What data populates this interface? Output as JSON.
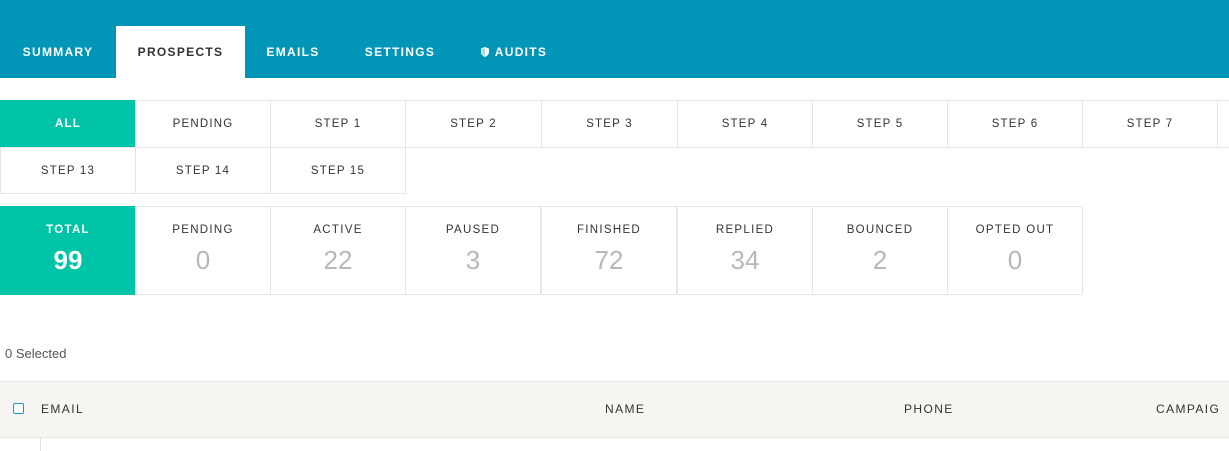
{
  "nav": {
    "tabs": [
      {
        "label": "SUMMARY",
        "active": false
      },
      {
        "label": "PROSPECTS",
        "active": true
      },
      {
        "label": "EMAILS",
        "active": false
      },
      {
        "label": "SETTINGS",
        "active": false
      },
      {
        "label": "AUDITS",
        "active": false,
        "icon": "shield-icon"
      }
    ]
  },
  "steps": {
    "row1": [
      "ALL",
      "PENDING",
      "STEP 1",
      "STEP 2",
      "STEP 3",
      "STEP 4",
      "STEP 5",
      "STEP 6",
      "STEP 7"
    ],
    "row2": [
      "STEP 13",
      "STEP 14",
      "STEP 15"
    ],
    "active": "ALL"
  },
  "stats": [
    {
      "label": "TOTAL",
      "value": "99",
      "active": true
    },
    {
      "label": "PENDING",
      "value": "0"
    },
    {
      "label": "ACTIVE",
      "value": "22"
    },
    {
      "label": "PAUSED",
      "value": "3"
    },
    {
      "label": "FINISHED",
      "value": "72"
    },
    {
      "label": "REPLIED",
      "value": "34"
    },
    {
      "label": "BOUNCED",
      "value": "2"
    },
    {
      "label": "OPTED OUT",
      "value": "0"
    }
  ],
  "selection": {
    "text": "0 Selected"
  },
  "table": {
    "columns": [
      "EMAIL",
      "NAME",
      "PHONE",
      "CAMPAIG"
    ]
  },
  "colors": {
    "nav_bg": "#0195b8",
    "accent": "#00c4a7",
    "header_bg": "#f6f5f2"
  }
}
